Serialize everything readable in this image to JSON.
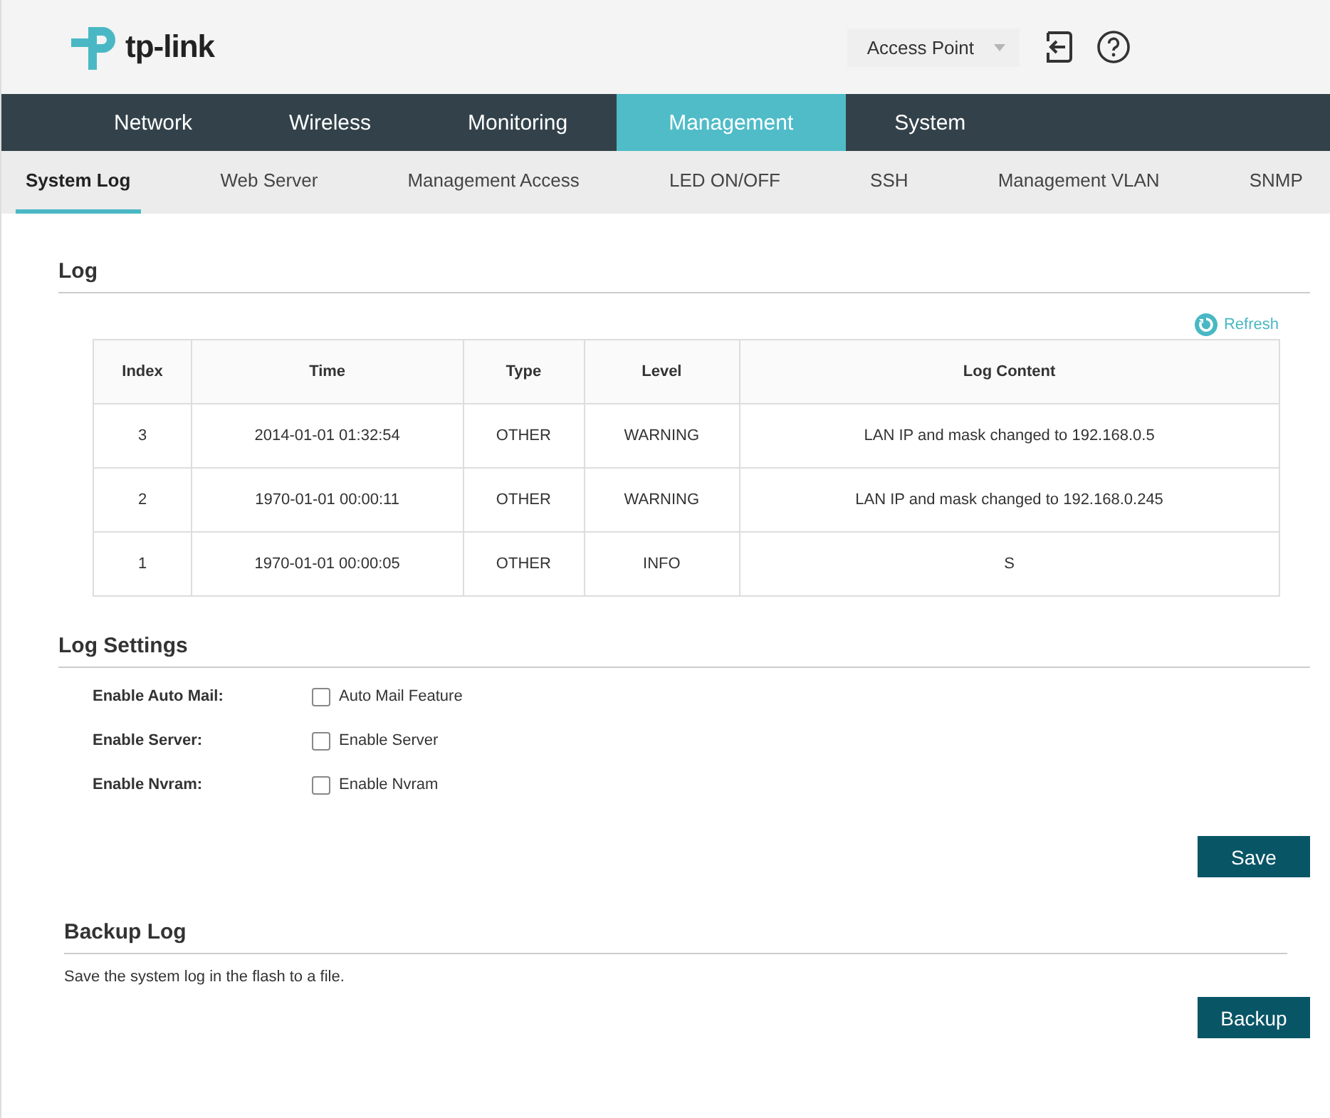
{
  "header": {
    "brand": "tp-link",
    "mode_select": "Access Point"
  },
  "main_tabs": [
    {
      "label": "Network",
      "selected": false
    },
    {
      "label": "Wireless",
      "selected": false
    },
    {
      "label": "Monitoring",
      "selected": false
    },
    {
      "label": "Management",
      "selected": true
    },
    {
      "label": "System",
      "selected": false
    }
  ],
  "sub_tabs": [
    {
      "label": "System Log",
      "selected": true
    },
    {
      "label": "Web Server",
      "selected": false
    },
    {
      "label": "Management Access",
      "selected": false
    },
    {
      "label": "LED ON/OFF",
      "selected": false
    },
    {
      "label": "SSH",
      "selected": false
    },
    {
      "label": "Management VLAN",
      "selected": false
    },
    {
      "label": "SNMP",
      "selected": false
    }
  ],
  "log": {
    "title": "Log",
    "refresh": "Refresh",
    "table": {
      "columns": [
        "Index",
        "Time",
        "Type",
        "Level",
        "Log Content"
      ],
      "rows": [
        [
          "3",
          "2014-01-01 01:32:54",
          "OTHER",
          "WARNING",
          "LAN IP and mask changed to 192.168.0.5"
        ],
        [
          "2",
          "1970-01-01 00:00:11",
          "OTHER",
          "WARNING",
          "LAN IP and mask changed to 192.168.0.245"
        ],
        [
          "1",
          "1970-01-01 00:00:05",
          "OTHER",
          "INFO",
          "S"
        ]
      ]
    }
  },
  "log_settings": {
    "title": "Log Settings",
    "fields": [
      {
        "label": "Enable Auto Mail:",
        "option": "Auto Mail Feature",
        "checked": false
      },
      {
        "label": "Enable Server:",
        "option": "Enable Server",
        "checked": false
      },
      {
        "label": "Enable Nvram:",
        "option": "Enable Nvram",
        "checked": false
      }
    ],
    "save_button": "Save"
  },
  "backup_log": {
    "title": "Backup Log",
    "description": "Save the system log in the flash to a file.",
    "backup_button": "Backup"
  }
}
